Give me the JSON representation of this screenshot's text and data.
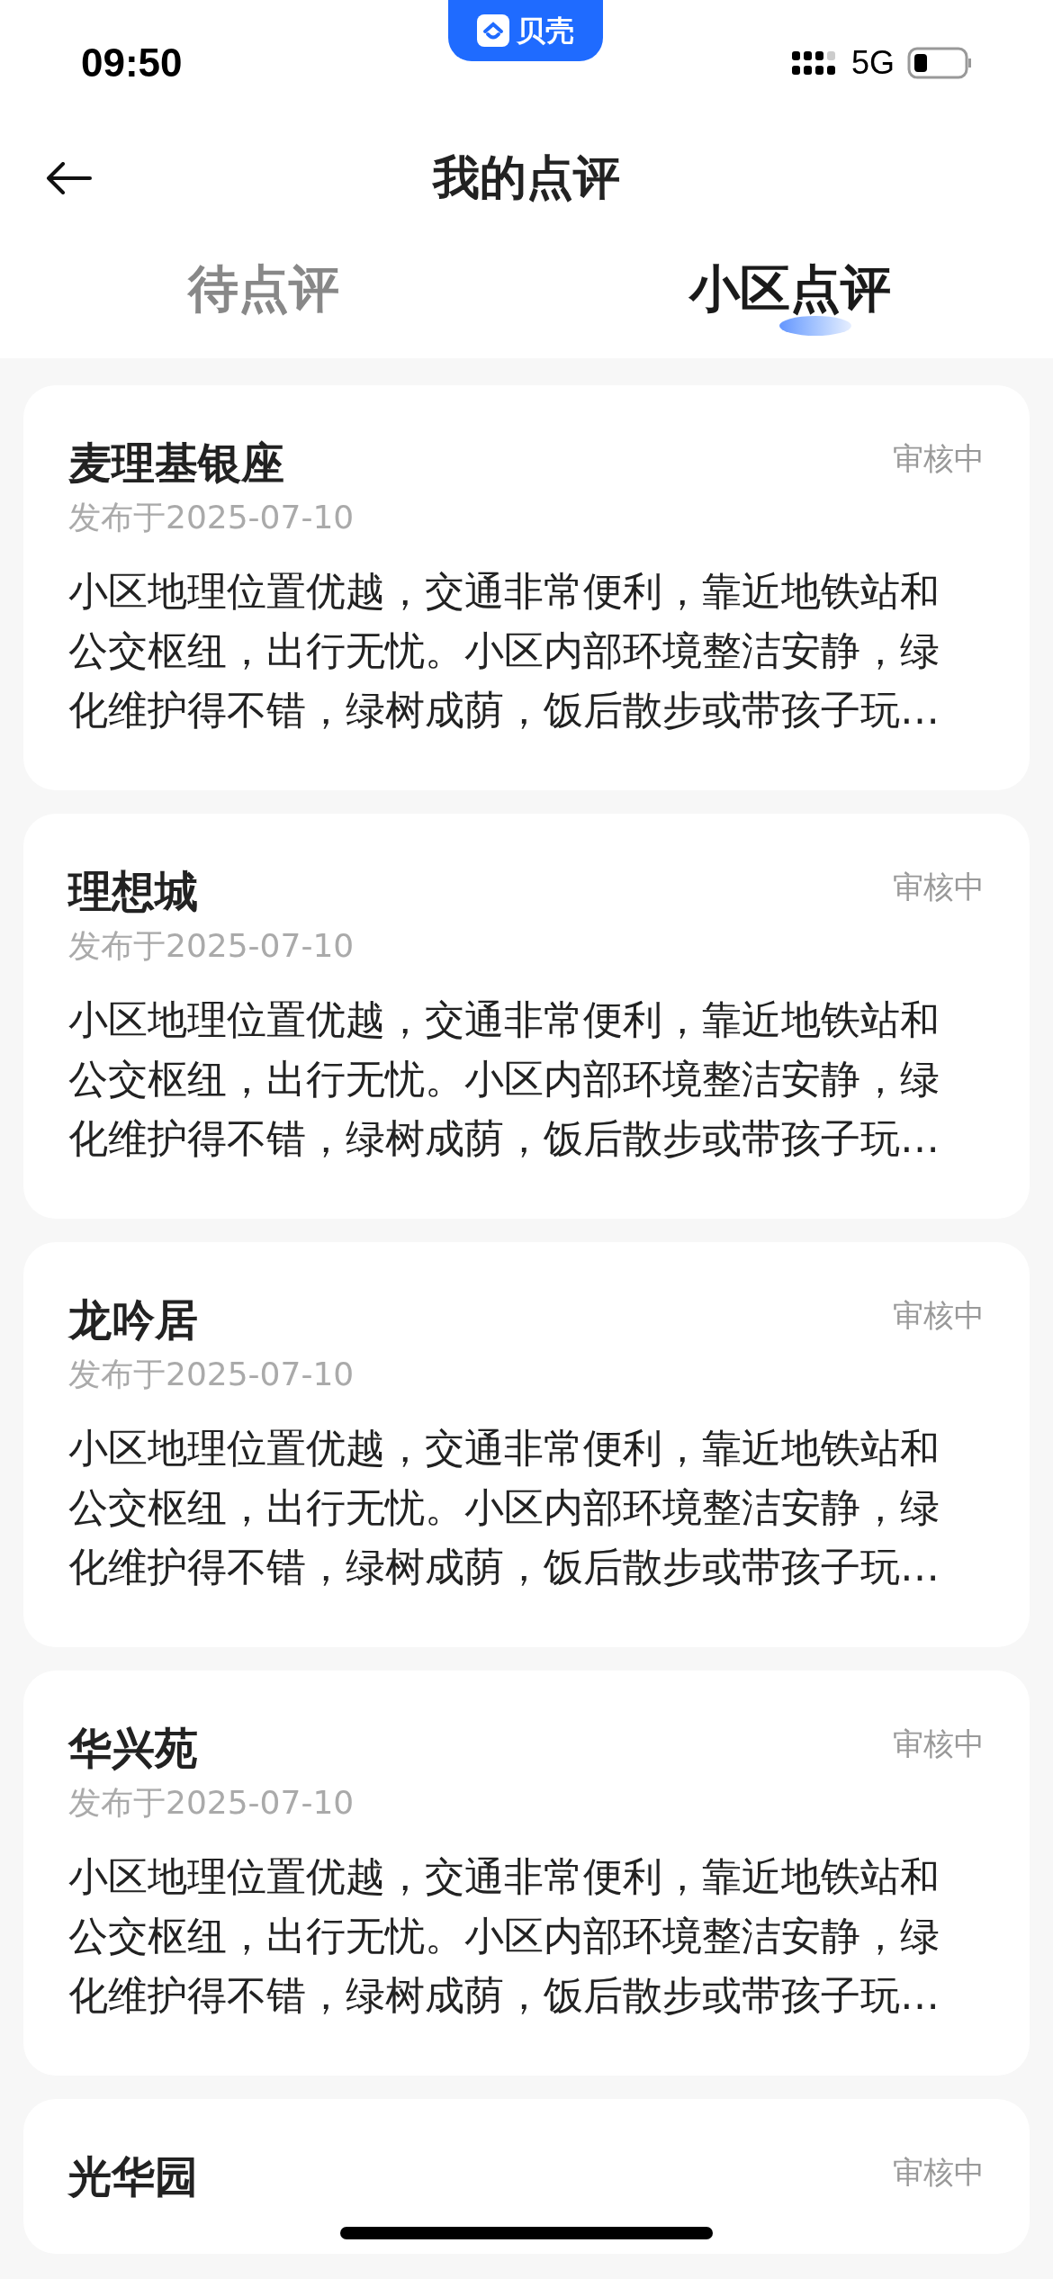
{
  "status_bar": {
    "time": "09:50",
    "network": "5G",
    "app_badge": "贝壳"
  },
  "header": {
    "title": "我的点评"
  },
  "tabs": [
    {
      "label": "待点评",
      "selected": false
    },
    {
      "label": "小区点评",
      "selected": true
    }
  ],
  "reviews": [
    {
      "community": "麦理基银座",
      "date": "发布于2025-07-10",
      "status": "审核中",
      "text": "小区地理位置优越，交通非常便利，靠近地铁站和公交枢纽，出行无忧。小区内部环境整洁安静，绿化维护得不错，绿树成荫，饭后散步或带孩子玩…"
    },
    {
      "community": "理想城",
      "date": "发布于2025-07-10",
      "status": "审核中",
      "text": "小区地理位置优越，交通非常便利，靠近地铁站和公交枢纽，出行无忧。小区内部环境整洁安静，绿化维护得不错，绿树成荫，饭后散步或带孩子玩…"
    },
    {
      "community": "龙吟居",
      "date": "发布于2025-07-10",
      "status": "审核中",
      "text": "小区地理位置优越，交通非常便利，靠近地铁站和公交枢纽，出行无忧。小区内部环境整洁安静，绿化维护得不错，绿树成荫，饭后散步或带孩子玩…"
    },
    {
      "community": "华兴苑",
      "date": "发布于2025-07-10",
      "status": "审核中",
      "text": "小区地理位置优越，交通非常便利，靠近地铁站和公交枢纽，出行无忧。小区内部环境整洁安静，绿化维护得不错，绿树成荫，饭后散步或带孩子玩…"
    },
    {
      "community": "光华园",
      "status": "审核中"
    }
  ]
}
